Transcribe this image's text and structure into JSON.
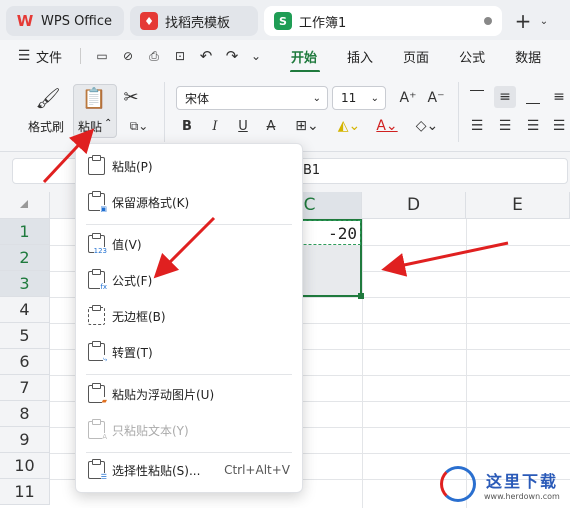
{
  "tabs": [
    {
      "label": "WPS Office",
      "icon": "wps-logo-icon"
    },
    {
      "label": "找稻壳模板",
      "icon": "docer-icon"
    },
    {
      "label": "工作簿1",
      "icon": "spreadsheet-icon",
      "icon_text": "S"
    }
  ],
  "menu": {
    "file": "文件",
    "tabs": [
      "开始",
      "插入",
      "页面",
      "公式",
      "数据"
    ]
  },
  "ribbon": {
    "format_painter": "格式刷",
    "paste": "粘贴",
    "font": "宋体",
    "size": "11"
  },
  "formula": {
    "cell_ref": "B1"
  },
  "columns": [
    "C",
    "D",
    "E"
  ],
  "rows": [
    "1",
    "2",
    "3",
    "4",
    "5",
    "6",
    "7",
    "8",
    "9",
    "10",
    "11"
  ],
  "cells": {
    "c1": "-20"
  },
  "paste_menu": {
    "items": [
      {
        "label": "粘贴(P)"
      },
      {
        "label": "保留源格式(K)"
      },
      {
        "label": "值(V)",
        "badge": "123"
      },
      {
        "label": "公式(F)",
        "badge": "fx"
      },
      {
        "label": "无边框(B)"
      },
      {
        "label": "转置(T)"
      },
      {
        "label": "粘贴为浮动图片(U)"
      },
      {
        "label": "只粘贴文本(Y)"
      },
      {
        "label": "选择性粘贴(S)...",
        "shortcut": "Ctrl+Alt+V"
      }
    ]
  },
  "watermark": {
    "text": "这里下载",
    "url": "www.herdown.com"
  },
  "colors": {
    "accent": "#1f7a3d",
    "arrow": "#e02020",
    "wps_red": "#e53935"
  }
}
